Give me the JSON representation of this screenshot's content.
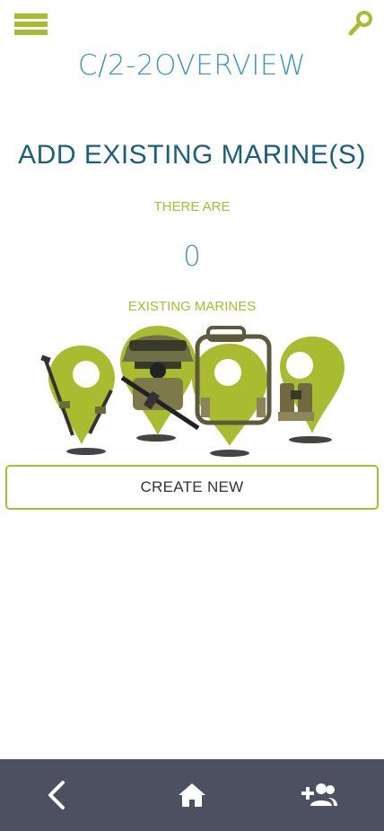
{
  "header": {
    "menu_icon": "hamburger-menu-icon",
    "search_icon": "search-icon",
    "title": "C/2-2OVERVIEW"
  },
  "main": {
    "headline": "ADD EXISTING MARINE(S)",
    "there_are_label": "THERE ARE",
    "count": "0",
    "existing_label": "EXISTING MARINES",
    "illustration_icon": "marine-gear-pins-illustration",
    "create_button_label": "CREATE NEW"
  },
  "bottom_nav": {
    "back_icon": "chevron-left-icon",
    "home_icon": "home-icon",
    "add_user_icon": "add-user-icon"
  },
  "colors": {
    "accent": "#a9bc2f",
    "title_blue": "#3d98c8",
    "headline_blue": "#1b5f7f",
    "nav_bar": "#4d5060"
  }
}
